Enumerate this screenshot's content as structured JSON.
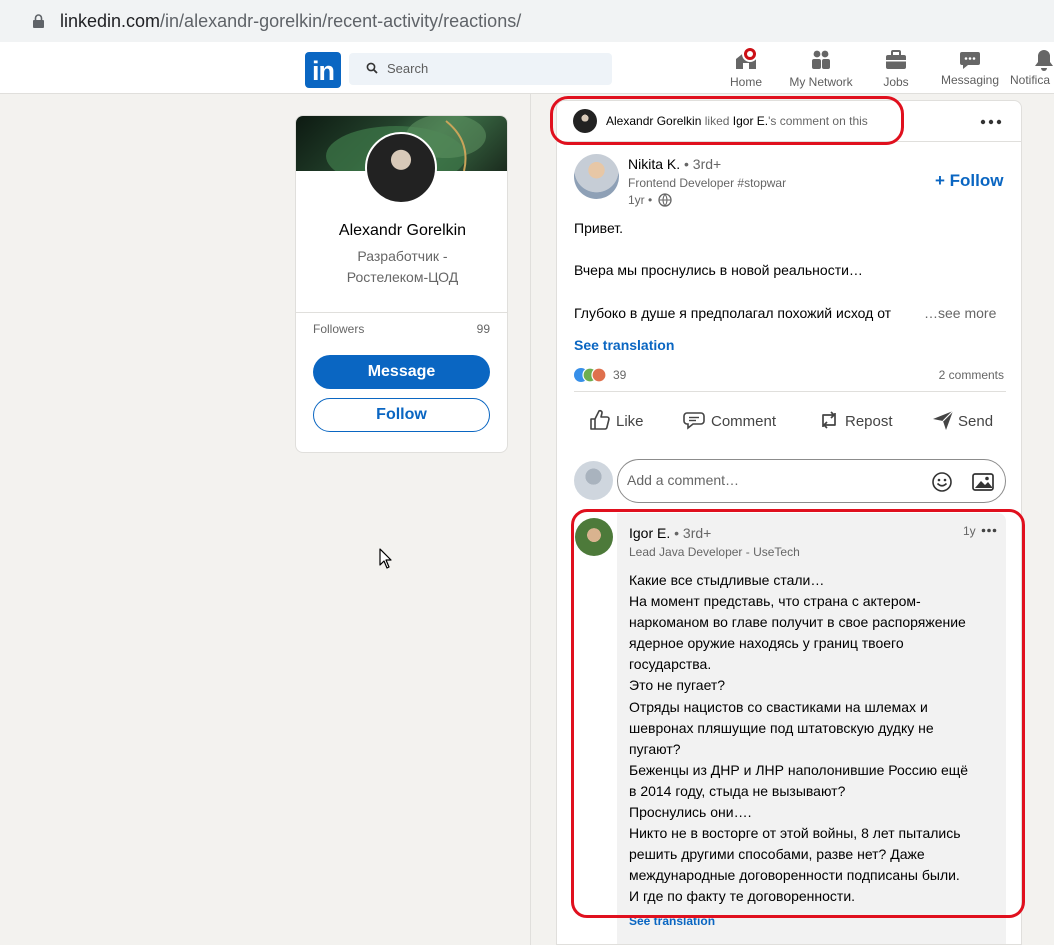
{
  "browser": {
    "url_host": "linkedin.com",
    "url_path": "/in/alexandr-gorelkin/recent-activity/reactions/"
  },
  "nav": {
    "logo": "in",
    "search_placeholder": "Search",
    "items": [
      {
        "label": "Home",
        "icon": "home-icon"
      },
      {
        "label": "My Network",
        "icon": "network-icon"
      },
      {
        "label": "Jobs",
        "icon": "jobs-icon"
      },
      {
        "label": "Messaging",
        "icon": "messaging-icon"
      },
      {
        "label": "Notifica",
        "icon": "bell-icon"
      }
    ]
  },
  "profile": {
    "name": "Alexandr Gorelkin",
    "headline": "Разработчик - Ростелеком-ЦОД",
    "followers_label": "Followers",
    "followers_count": "99",
    "message_label": "Message",
    "follow_label": "Follow"
  },
  "activity": {
    "actor": "Alexandr Gorelkin",
    "verb": "liked",
    "target": "Igor E.",
    "suffix": "'s comment on this"
  },
  "post": {
    "author": "Nikita K.",
    "degree": "• 3rd+",
    "headline": "Frontend Developer #stopwar",
    "time": "1yr •",
    "follow_label": "+ Follow",
    "lines": [
      "Привет.",
      "Вчера мы проснулись в новой реальности…",
      "Глубоко в душе я предполагал похожий исход от"
    ],
    "see_more": "…see more",
    "see_translation": "See translation",
    "reactions_count": "39",
    "comments_count": "2 comments"
  },
  "actions": {
    "like": "Like",
    "comment": "Comment",
    "repost": "Repost",
    "send": "Send"
  },
  "comment_input": {
    "placeholder": "Add a comment…"
  },
  "comment": {
    "author": "Igor E.",
    "degree": "• 3rd+",
    "headline": "Lead Java Developer - UseTech",
    "time": "1y",
    "lines": [
      "Какие все стыдливые стали…",
      "На момент представь, что страна с актером-",
      "наркоманом во главе получит в свое распоряжение",
      "ядерное оружие находясь у границ твоего",
      "государства.",
      "Это не пугает?",
      "Отряды нацистов со свастиками на шлемах и",
      "шевронах пляшущие под штатовскую дудку не",
      "пугают?",
      "Беженцы из ДНР и ЛНР наполонившие Россию ещё",
      "в 2014 году, стыда не вызывают?",
      "Проснулись они….",
      "Никто не в восторге от этой войны, 8 лет пытались",
      "решить другими способами, разве нет? Даже",
      "международные договоренности подписаны были.",
      "И где по факту те договоренности."
    ],
    "see_translation": "See translation"
  },
  "colors": {
    "brand": "#0a66c2",
    "annotation": "#e0101e",
    "page_bg": "#f3f2ef"
  }
}
